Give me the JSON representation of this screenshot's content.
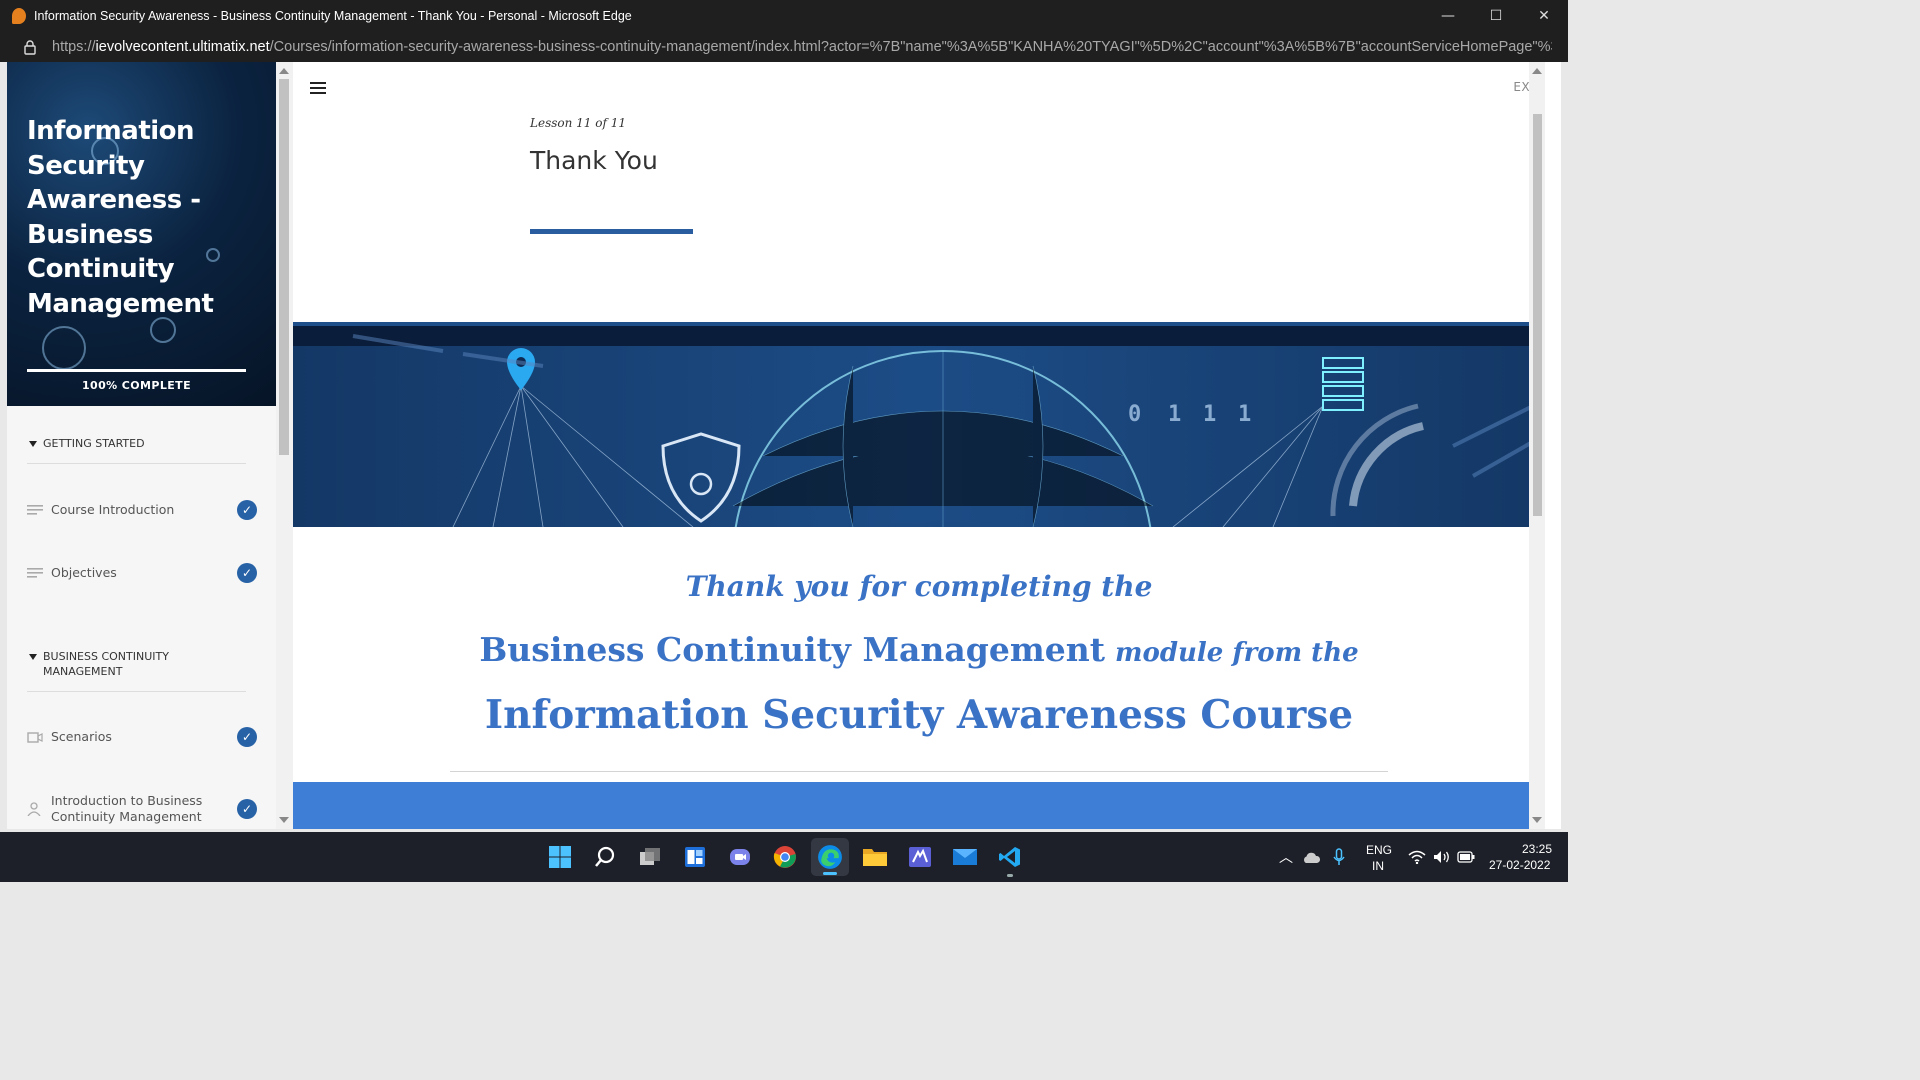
{
  "window": {
    "title": "Information Security Awareness - Business Continuity Management - Thank You - Personal - Microsoft Edge",
    "minimize": "—",
    "maximize": "☐",
    "close": "✕"
  },
  "address": {
    "scheme": "https://",
    "host": "ievolvecontent.ultimatix.net",
    "path": "/Courses/information-security-awareness-business-continuity-management/index.html?actor=%7B\"name\"%3A%5B\"KANHA%20TYAGI\"%5D%2C\"account\"%3A%5B%7B\"accountServiceHomePage\"%3A..."
  },
  "sidebar": {
    "course_title": "Information Security Awareness - Business Continuity Management",
    "progress_label": "100% COMPLETE",
    "progress": 1.0,
    "sections": [
      {
        "label": "GETTING STARTED"
      },
      {
        "label": "BUSINESS CONTINUITY MANAGEMENT"
      }
    ],
    "items": [
      {
        "label": "Course Introduction",
        "icon": "text-lines-icon",
        "status": "completed"
      },
      {
        "label": "Objectives",
        "icon": "text-lines-icon",
        "status": "completed"
      },
      {
        "label": "Scenarios",
        "icon": "video-icon",
        "status": "completed"
      },
      {
        "label": "Introduction to Business Continuity Management",
        "icon": "person-icon",
        "status": "completed"
      }
    ]
  },
  "main": {
    "exit_label": "EXIT",
    "lesson_counter": "Lesson 11 of 11",
    "lesson_title": "Thank You",
    "thanks_line1": "Thank you for completing the",
    "thanks_module": "Business Continuity Management",
    "thanks_module_suffix": "module from the",
    "thanks_course": "Information Security Awareness Course"
  },
  "taskbar": {
    "language": "ENG",
    "region": "IN",
    "time": "23:25",
    "date": "27-02-2022",
    "apps": [
      "windows-start-icon",
      "search-icon",
      "task-view-icon",
      "widgets-icon",
      "teams-chat-icon",
      "chrome-icon",
      "edge-icon",
      "file-explorer-icon",
      "app-icon",
      "mail-icon",
      "vscode-icon"
    ]
  },
  "colors": {
    "accent": "#2762a6",
    "heading_blue": "#3a72c6",
    "banner_dark": "#0e2a52"
  }
}
